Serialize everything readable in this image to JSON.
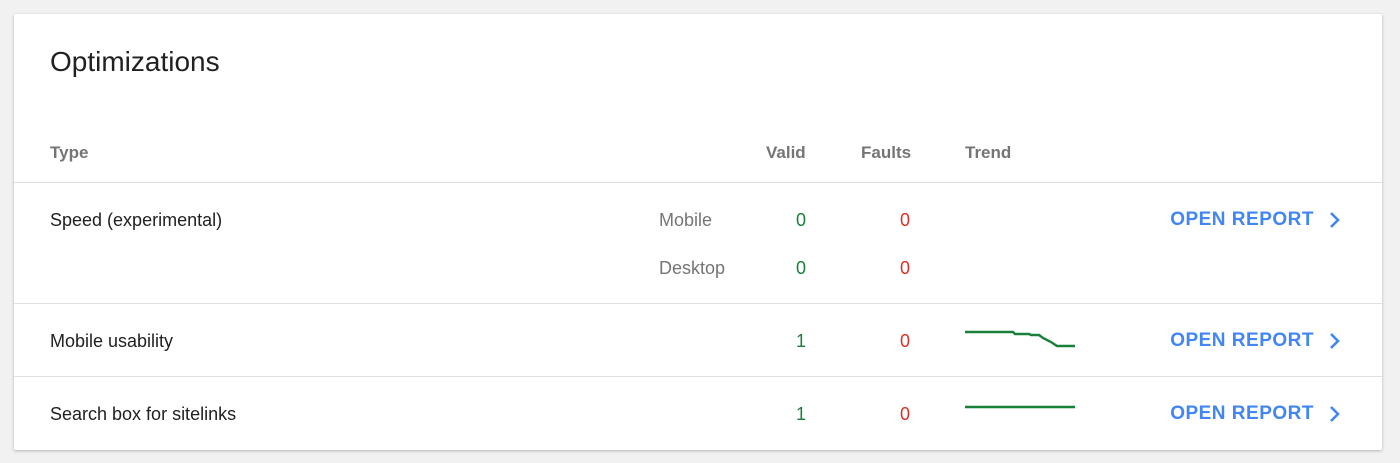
{
  "title": "Optimizations",
  "columns": {
    "type": "Type",
    "valid": "Valid",
    "faults": "Faults",
    "trend": "Trend"
  },
  "rows": [
    {
      "type": "Speed (experimental)",
      "sub": [
        {
          "device": "Mobile",
          "valid": "0",
          "faults": "0"
        },
        {
          "device": "Desktop",
          "valid": "0",
          "faults": "0"
        }
      ],
      "action": "OPEN REPORT"
    },
    {
      "type": "Mobile usability",
      "valid": "1",
      "faults": "0",
      "trend": "declining-step",
      "action": "OPEN REPORT"
    },
    {
      "type": "Search box for sitelinks",
      "valid": "1",
      "faults": "0",
      "trend": "flat",
      "action": "OPEN REPORT"
    }
  ],
  "colors": {
    "valid": "#188038",
    "faults": "#d93025",
    "link": "#4285f4",
    "trend": "#188038"
  },
  "icons": {
    "open_report": "chevron-right-icon"
  }
}
